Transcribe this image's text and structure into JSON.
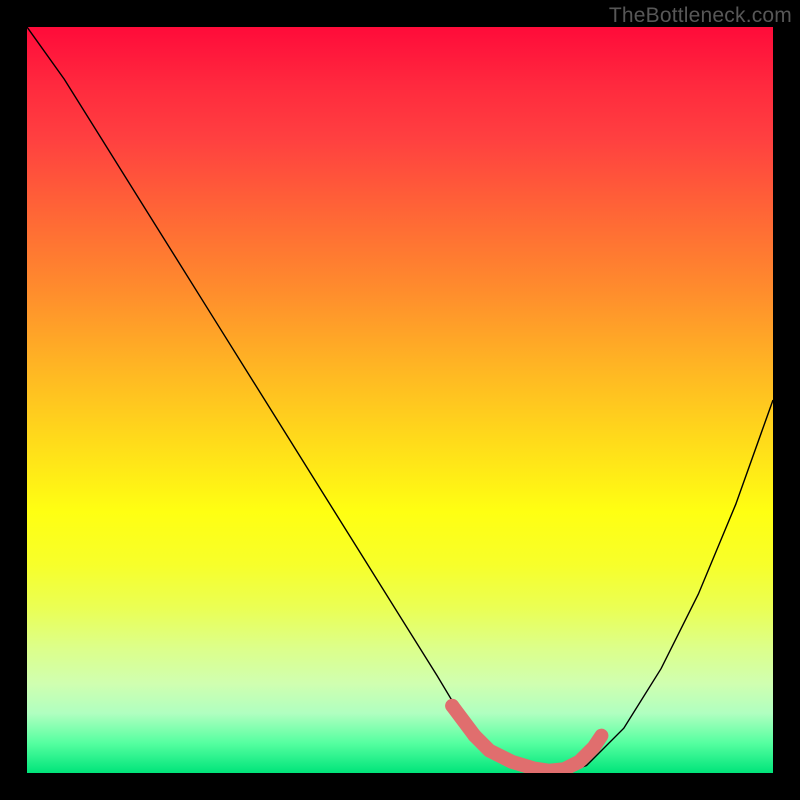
{
  "watermark": "TheBottleneck.com",
  "chart_data": {
    "type": "line",
    "title": "",
    "xlabel": "",
    "ylabel": "",
    "x_range": [
      0,
      100
    ],
    "y_range": [
      0,
      100
    ],
    "series": [
      {
        "name": "bottleneck-curve",
        "x": [
          0,
          5,
          10,
          15,
          20,
          25,
          30,
          35,
          40,
          45,
          50,
          55,
          58,
          62,
          66,
          70,
          72,
          75,
          80,
          85,
          90,
          95,
          100
        ],
        "y": [
          100,
          93,
          85,
          77,
          69,
          61,
          53,
          45,
          37,
          29,
          21,
          13,
          8,
          4,
          1,
          0,
          0,
          1,
          6,
          14,
          24,
          36,
          50
        ],
        "stroke": "#000000",
        "stroke_width": 1.4
      }
    ],
    "highlight": {
      "name": "optimal-range",
      "points": [
        {
          "x": 57,
          "y": 9
        },
        {
          "x": 60,
          "y": 5
        },
        {
          "x": 62,
          "y": 3
        },
        {
          "x": 65,
          "y": 1.5
        },
        {
          "x": 68,
          "y": 0.6
        },
        {
          "x": 70,
          "y": 0.3
        },
        {
          "x": 72,
          "y": 0.5
        },
        {
          "x": 74,
          "y": 1.5
        },
        {
          "x": 76,
          "y": 3.5
        },
        {
          "x": 77,
          "y": 5
        }
      ],
      "stroke": "#e06e6e",
      "stroke_width": 14
    },
    "highlight_endpoints": {
      "points": [
        {
          "x": 57,
          "y": 9
        },
        {
          "x": 60,
          "y": 5
        }
      ],
      "radius": 7,
      "fill": "#e06e6e"
    },
    "gradient_bands": {
      "top_color": "#ff0b3a",
      "bottom_color": "#00e47a"
    }
  }
}
